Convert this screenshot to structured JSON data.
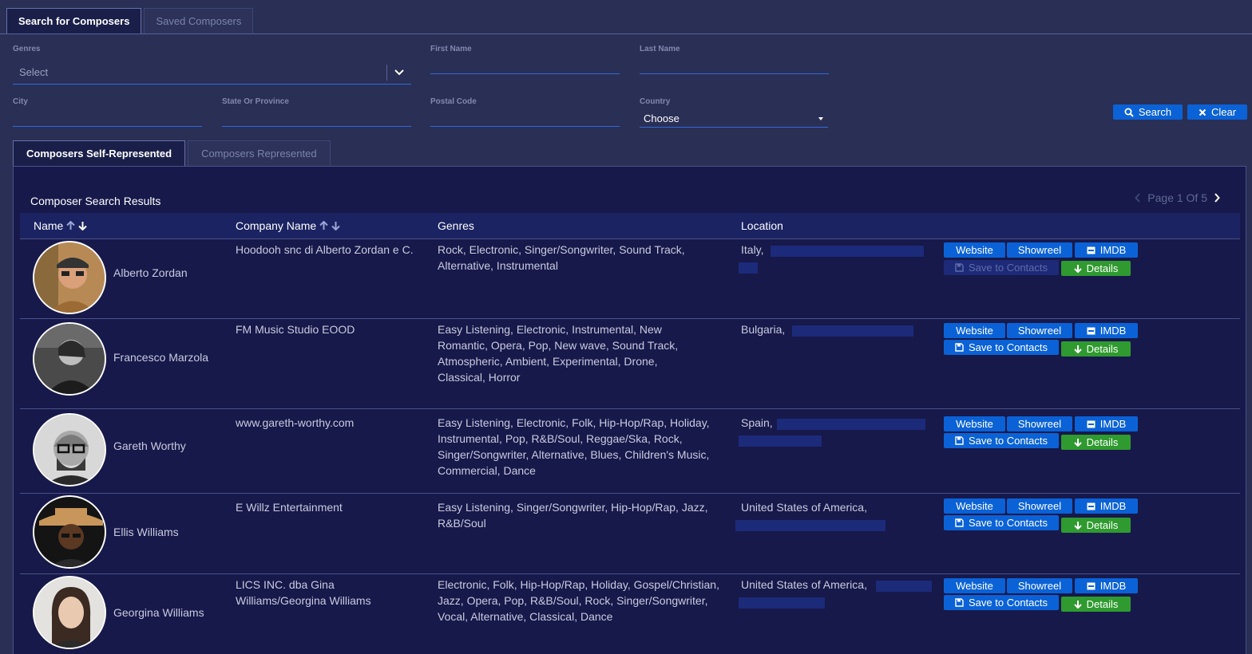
{
  "top_tabs": [
    {
      "label": "Search for Composers",
      "active": true
    },
    {
      "label": "Saved Composers",
      "active": false
    }
  ],
  "filters": {
    "genres": {
      "label": "Genres",
      "placeholder": "Select"
    },
    "first_name": {
      "label": "First Name",
      "value": ""
    },
    "last_name": {
      "label": "Last Name",
      "value": ""
    },
    "city": {
      "label": "City",
      "value": ""
    },
    "state": {
      "label": "State Or Province",
      "value": ""
    },
    "postal": {
      "label": "Postal Code",
      "value": ""
    },
    "country": {
      "label": "Country",
      "value": "Choose"
    }
  },
  "actions": {
    "search": "Search",
    "clear": "Clear"
  },
  "inner_tabs": [
    {
      "label": "Composers Self-Represented",
      "active": true
    },
    {
      "label": "Composers Represented",
      "active": false
    }
  ],
  "results": {
    "title": "Composer Search Results",
    "pager": "Page 1 Of 5",
    "columns": {
      "name": "Name",
      "company": "Company Name",
      "genres": "Genres",
      "location": "Location"
    },
    "buttons": {
      "website": "Website",
      "showreel": "Showreel",
      "imdb": "IMDB",
      "save": "Save to Contacts",
      "details": "Details"
    },
    "rows": [
      {
        "name": "Alberto Zordan",
        "company": "Hoodooh snc di Alberto Zordan e C.",
        "genres": "Rock, Electronic, Singer/Songwriter, Sound Track, Alternative, Instrumental",
        "location": "Italy,",
        "save_disabled": true
      },
      {
        "name": "Francesco Marzola",
        "company": "FM Music Studio EOOD",
        "genres": "Easy Listening, Electronic, Instrumental, New Romantic, Opera, Pop, New wave, Sound Track, Atmospheric, Ambient, Experimental, Drone, Classical, Horror",
        "location": "Bulgaria,",
        "save_disabled": false
      },
      {
        "name": "Gareth Worthy",
        "company": "www.gareth-worthy.com",
        "genres": "Easy Listening, Electronic, Folk, Hip-Hop/Rap, Holiday, Instrumental, Pop, R&B/Soul, Reggae/Ska, Rock, Singer/Songwriter, Alternative, Blues, Children's Music, Commercial, Dance",
        "location": "Spain,",
        "save_disabled": false
      },
      {
        "name": "Ellis Williams",
        "company": "E Willz Entertainment",
        "genres": "Easy Listening, Singer/Songwriter, Hip-Hop/Rap, Jazz, R&B/Soul",
        "location": "United States of America,",
        "save_disabled": false
      },
      {
        "name": "Georgina Williams",
        "company": "LICS INC. dba Gina Williams/Georgina Williams",
        "genres": "Electronic, Folk, Hip-Hop/Rap, Holiday, Gospel/Christian, Jazz, Opera, Pop, R&B/Soul, Rock, Singer/Songwriter, Vocal, Alternative, Classical, Dance",
        "location": "United States of America,",
        "save_disabled": false
      }
    ]
  }
}
